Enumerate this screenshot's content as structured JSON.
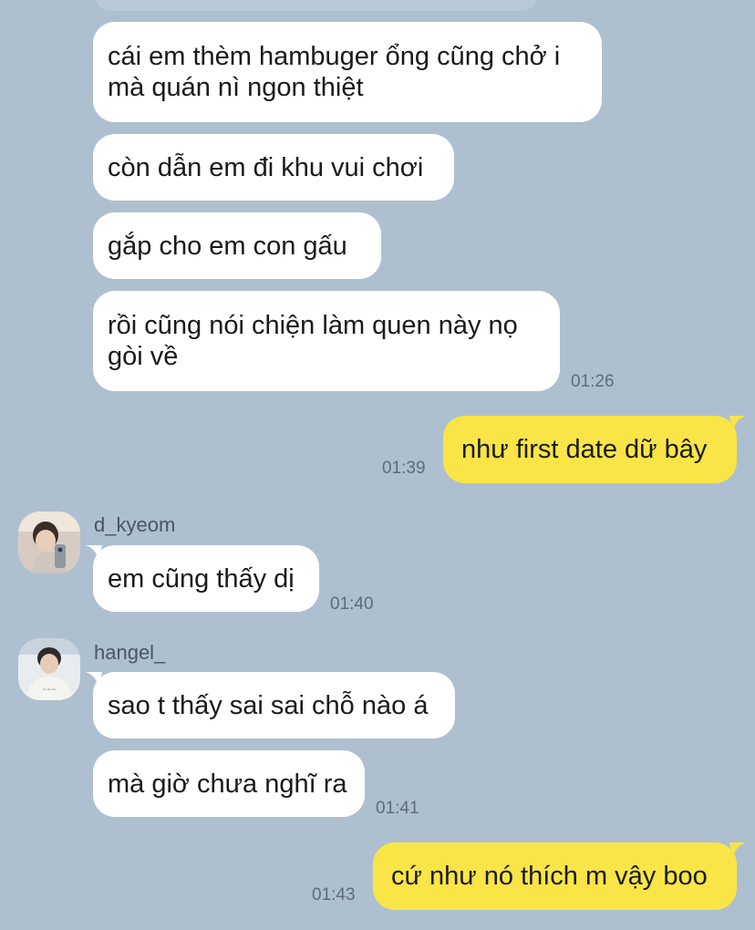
{
  "messages": [
    {
      "text": "cái em thèm hambuger ổng cũng chở i\nmà quán nì ngon thiệt"
    },
    {
      "text": "còn dẫn em đi khu vui chơi"
    },
    {
      "text": "gắp cho em con gấu"
    },
    {
      "text": "rồi cũng nói chiện làm quen này nọ\ngòi về",
      "time": "01:26"
    },
    {
      "text": "như first date dữ bây",
      "time": "01:39"
    },
    {
      "sender": "d_kyeom",
      "text": "em cũng thấy dị",
      "time": "01:40"
    },
    {
      "sender": "hangel_",
      "text": "sao t thấy sai sai chỗ nào á"
    },
    {
      "text": "mà giờ chưa nghĩ ra",
      "time": "01:41"
    },
    {
      "text": "cứ như nó thích m vậy boo",
      "time": "01:43"
    }
  ],
  "colors": {
    "background": "#aec0d0",
    "incoming_bubble": "#ffffff",
    "outgoing_bubble": "#f9e547"
  }
}
